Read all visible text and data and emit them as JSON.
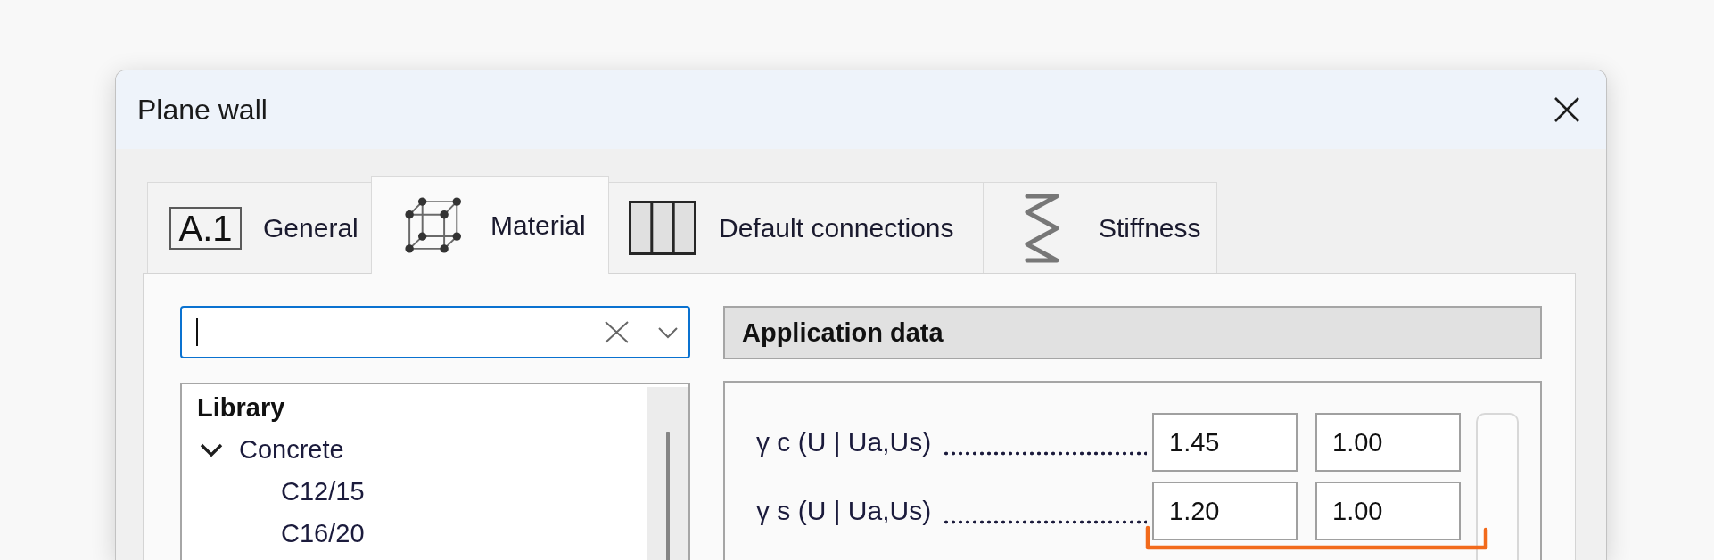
{
  "window": {
    "title": "Plane wall"
  },
  "tabs": [
    {
      "label": "General",
      "kind": "number",
      "icon_text": "A.1",
      "selected": false
    },
    {
      "label": "Material",
      "kind": "cube",
      "selected": true
    },
    {
      "label": "Default connections",
      "kind": "columns",
      "selected": false
    },
    {
      "label": "Stiffness",
      "kind": "spring",
      "selected": false
    }
  ],
  "search": {
    "focused": true
  },
  "tree": {
    "title": "Library",
    "items": [
      {
        "label": "Concrete",
        "expanded": true,
        "selected": false,
        "children": [
          {
            "label": "C12/15",
            "selected": false
          },
          {
            "label": "C16/20",
            "selected": false
          }
        ]
      }
    ]
  },
  "application_data": {
    "title": "Application data",
    "rows": [
      {
        "label": "γ c (U | Ua,Us)",
        "values": [
          "1.45",
          "1.00"
        ],
        "highlighted": false
      },
      {
        "label": "γ s (U | Ua,Us)",
        "values": [
          "1.20",
          "1.00"
        ],
        "highlighted": true
      }
    ]
  }
}
